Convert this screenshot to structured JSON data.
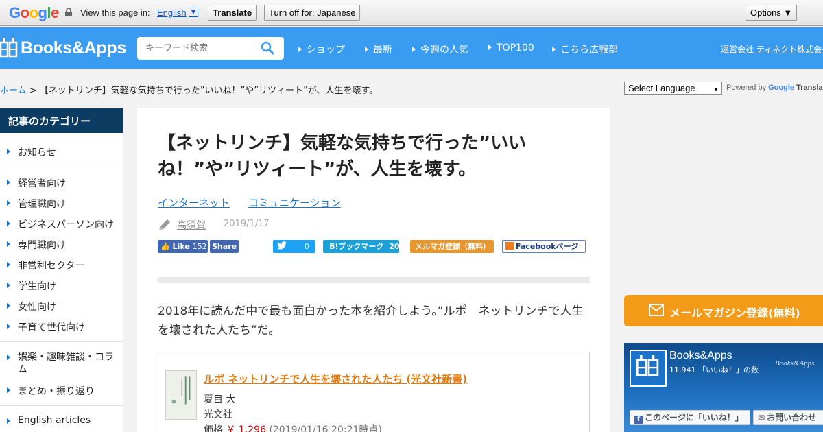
{
  "translate_bar": {
    "logo_letters": [
      "G",
      "o",
      "o",
      "g",
      "l",
      "e"
    ],
    "logo_colors": [
      "#4285f4",
      "#ea4335",
      "#fbbc05",
      "#4285f4",
      "#34a853",
      "#ea4335"
    ],
    "view_label": "View this page in:",
    "language": "English",
    "translate_button": "Translate",
    "turn_off_button": "Turn off for: Japanese",
    "options_button": "Options ▼"
  },
  "header": {
    "logo_text": "Books&Apps",
    "search_placeholder": "キーワード検索",
    "nav": [
      "ショップ",
      "最新",
      "今週の人気",
      "TOP100",
      "こちら広報部"
    ],
    "company_link": "運営会社 ティネクト株式会社"
  },
  "breadcrumb": {
    "home": "ホーム",
    "separator": " > ",
    "current": "【ネットリンチ】気軽な気持ちで行った”いいね！”や”リツィート”が、人生を壊す。"
  },
  "translate_widget": {
    "select_label": "Select Language",
    "powered_by": "Powered by",
    "google": "Google",
    "translate": "Translate"
  },
  "sidebar": {
    "title": "記事のカテゴリー",
    "items": [
      "お知らせ",
      "経営者向け",
      "管理職向け",
      "ビジネスパーソン向け",
      "専門職向け",
      "非営利セクター",
      "学生向け",
      "女性向け",
      "子育て世代向け",
      "娯楽・趣味雑談・コラム",
      "まとめ・振り返り",
      "English articles"
    ]
  },
  "article": {
    "title": "【ネットリンチ】気軽な気持ちで行った”いいね！”や”リツィート”が、人生を壊す。",
    "tags": [
      "インターネット",
      "コミュニケーション"
    ],
    "author": "高須賀",
    "date": "2019/1/17",
    "share": {
      "fb_like": "Like",
      "fb_like_count": "152",
      "fb_share": "Share",
      "tw_count": "0",
      "hatena_label": "ブックマーク",
      "hatena_prefix": "B!",
      "hatena_count": "20",
      "mailmag": "メルマガ登録（無料）",
      "fb_page": "Facebookページ"
    },
    "lead": "2018年に読んだ中で最も面白かった本を紹介しよう。”ルポ　ネットリンチで人生を壊された人たち”だ。",
    "book": {
      "title": "ルポ ネットリンチで人生を壊された人たち (光文社新書)",
      "author": "夏目 大",
      "publisher": "光文社",
      "price_label": "価格",
      "price": "￥ 1,296",
      "price_note": "(2019/01/16 20:21時点)"
    }
  },
  "right": {
    "mail_banner": "メールマガジン登録(無料)",
    "fb_widget": {
      "name": "Books&Apps",
      "count": "11,941 「いいね！」の数",
      "watermark": "Books&Apps",
      "like_page": "このページに「いいね！」",
      "contact": "お問い合わせ"
    }
  }
}
